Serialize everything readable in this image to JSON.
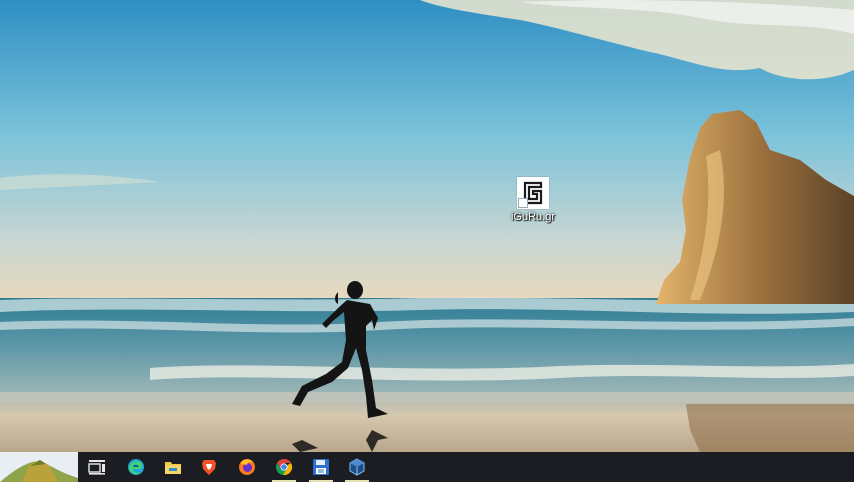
{
  "desktop": {
    "icons": [
      {
        "label": "iGuRu.gr",
        "icon": "iguru-shortcut-icon"
      }
    ]
  },
  "taskbar": {
    "start": {
      "icon": "start-landscape-thumbnail"
    },
    "items": [
      {
        "icon": "task-view-icon",
        "running": false
      },
      {
        "icon": "edge-browser-icon",
        "running": false
      },
      {
        "icon": "file-explorer-icon",
        "running": false
      },
      {
        "icon": "brave-browser-icon",
        "running": false
      },
      {
        "icon": "firefox-icon",
        "running": false
      },
      {
        "icon": "chrome-icon",
        "running": true
      },
      {
        "icon": "floppy-save-app-icon",
        "running": true
      },
      {
        "icon": "virtualbox-icon",
        "running": true
      }
    ]
  },
  "colors": {
    "taskbar": "#1b1d22",
    "running_indicator": "#e4e0b0"
  }
}
